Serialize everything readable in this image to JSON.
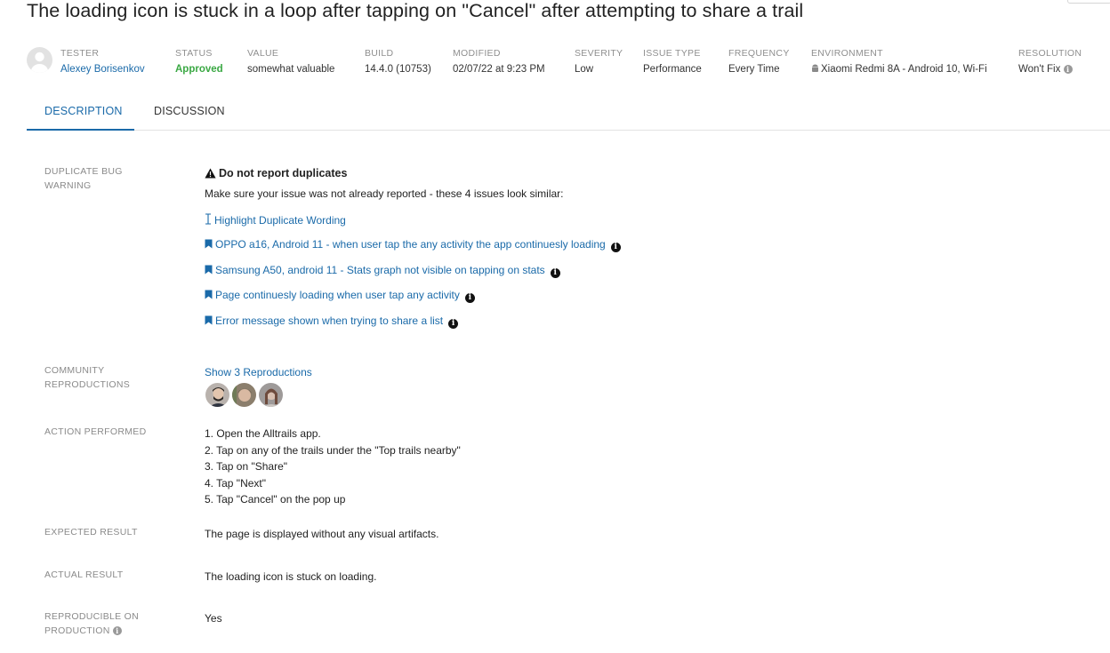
{
  "title": "The loading icon is stuck in a loop after tapping on \"Cancel\" after attempting to share a trail",
  "meta": {
    "tester": {
      "label": "TESTER",
      "value": "Alexey Borisenkov"
    },
    "status": {
      "label": "STATUS",
      "value": "Approved"
    },
    "value": {
      "label": "VALUE",
      "value": "somewhat valuable"
    },
    "build": {
      "label": "BUILD",
      "value": "14.4.0 (10753)"
    },
    "modified": {
      "label": "MODIFIED",
      "value": "02/07/22 at 9:23 PM"
    },
    "severity": {
      "label": "SEVERITY",
      "value": "Low"
    },
    "issue_type": {
      "label": "ISSUE TYPE",
      "value": "Performance"
    },
    "frequency": {
      "label": "FREQUENCY",
      "value": "Every Time"
    },
    "environment": {
      "label": "ENVIRONMENT",
      "value": "Xiaomi Redmi 8A - Android 10, Wi-Fi"
    },
    "resolution": {
      "label": "RESOLUTION",
      "value": "Won't Fix"
    }
  },
  "tabs": {
    "description": "DESCRIPTION",
    "discussion": "DISCUSSION"
  },
  "duplicate": {
    "label_line1": "DUPLICATE BUG",
    "label_line2": "WARNING",
    "warning_title": "Do not report duplicates",
    "warning_text": "Make sure your issue was not already reported - these 4 issues look similar:",
    "highlight_link": "Highlight Duplicate Wording",
    "issues": [
      "OPPO a16, Android 11 - when user tap the any activity the app continuesly loading",
      "Samsung A50, android 11 - Stats graph not visible on tapping on stats",
      "Page continuesly loading when user tap any activity",
      "Error message shown when trying to share a list"
    ]
  },
  "community": {
    "label_line1": "COMMUNITY",
    "label_line2": "REPRODUCTIONS",
    "link": "Show 3 Reproductions"
  },
  "action": {
    "label": "ACTION PERFORMED",
    "steps": [
      "1. Open the Alltrails app.",
      "2. Tap on any of the trails under the \"Top trails nearby\"",
      "3. Tap on \"Share\"",
      "4. Tap \"Next\"",
      "5. Tap \"Cancel\" on the pop up"
    ]
  },
  "expected": {
    "label": "EXPECTED RESULT",
    "value": "The page is displayed without any visual artifacts."
  },
  "actual": {
    "label": "ACTUAL RESULT",
    "value": "The loading icon is stuck on loading."
  },
  "reproducible": {
    "label_line1": "REPRODUCIBLE ON",
    "label_line2": "PRODUCTION",
    "value": "Yes"
  },
  "colors": {
    "link": "#1a6aa9",
    "approved": "#3aa843",
    "label": "#8a8a8a"
  }
}
